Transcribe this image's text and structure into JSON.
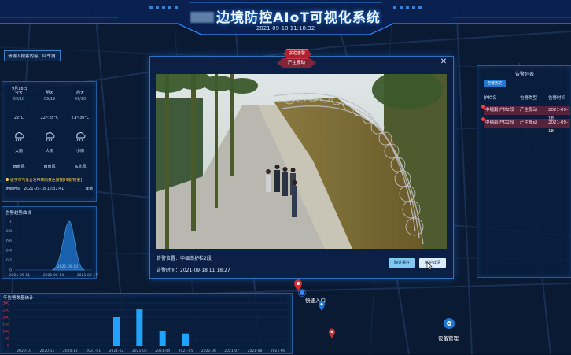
{
  "header": {
    "title": "边境防控AIoT可视化系统",
    "datetime": "2021-09-18 11:18:32"
  },
  "search": {
    "placeholder": "请输入搜索内容、回车搜"
  },
  "weather": {
    "date": "9月18日",
    "days": [
      {
        "day": "今天",
        "date": "09/18",
        "temp": "22°C",
        "cond": "大雨",
        "wind": "西南风"
      },
      {
        "day": "明天",
        "date": "09/19",
        "temp": "22~28°C",
        "cond": "大雨",
        "wind": "西南风"
      },
      {
        "day": "后天",
        "date": "09/20",
        "temp": "21~30°C",
        "cond": "小雨",
        "wind": "东北风"
      }
    ],
    "warning": "遂宁市气象台发布暴雨黄色预警[III级/较重]",
    "update_label": "更新时间",
    "update_time": "2021-09-18 10:37:41",
    "detail": "详情"
  },
  "alarm_curve": {
    "title": "告警趋势曲线",
    "chart_data": {
      "type": "area",
      "x": [
        "2021-09-11",
        "2021-09-14",
        "2021-09-17"
      ],
      "y_ticks": [
        "1",
        "0.8",
        "0.6",
        "0.4",
        "0.2",
        "0"
      ],
      "peak_label": "2021-09-14",
      "peak_value": 1,
      "ylim": [
        0,
        1
      ]
    }
  },
  "year_count": {
    "title": "年告警数量统计",
    "chart_data": {
      "type": "bar",
      "categories": [
        "2020-10",
        "2020-11",
        "2020-12",
        "2021-01",
        "2021-02",
        "2021-03",
        "2021-04",
        "2021-05",
        "2021-06",
        "2021-07",
        "2021-08",
        "2021-09"
      ],
      "values": [
        0,
        0,
        0,
        0,
        200,
        255,
        100,
        85,
        0,
        0,
        0,
        0
      ],
      "y_ticks": [
        "300",
        "250",
        "200",
        "150",
        "100",
        "50",
        "0"
      ],
      "ylim": [
        0,
        300
      ]
    }
  },
  "alarm_list": {
    "title": "告警列表",
    "history_btn": "告警历史",
    "columns": [
      "护栏名",
      "告警类型",
      "告警时间"
    ],
    "rows": [
      {
        "name": "中缅南护栏2段",
        "type": "产生振动",
        "time": "2021-09-18"
      },
      {
        "name": "中缅南护栏2段",
        "type": "产生振动",
        "time": "2021-09-18"
      }
    ]
  },
  "modal": {
    "tab": "护栏告警",
    "subtitle": "产生振动",
    "location_label": "告警位置：",
    "location": "中缅南护栏2段",
    "time_label": "告警时间：",
    "time": "2021-09-18 11:18:27",
    "confirm_btn": "确认事件",
    "patrol_btn": "巡护详情"
  },
  "map": {
    "quick_entry": "快速入口",
    "device_mgmt": "设备管理"
  },
  "colors": {
    "accent": "#1f78d2",
    "alarm": "#b02030",
    "bar": "#1fa3ff"
  }
}
